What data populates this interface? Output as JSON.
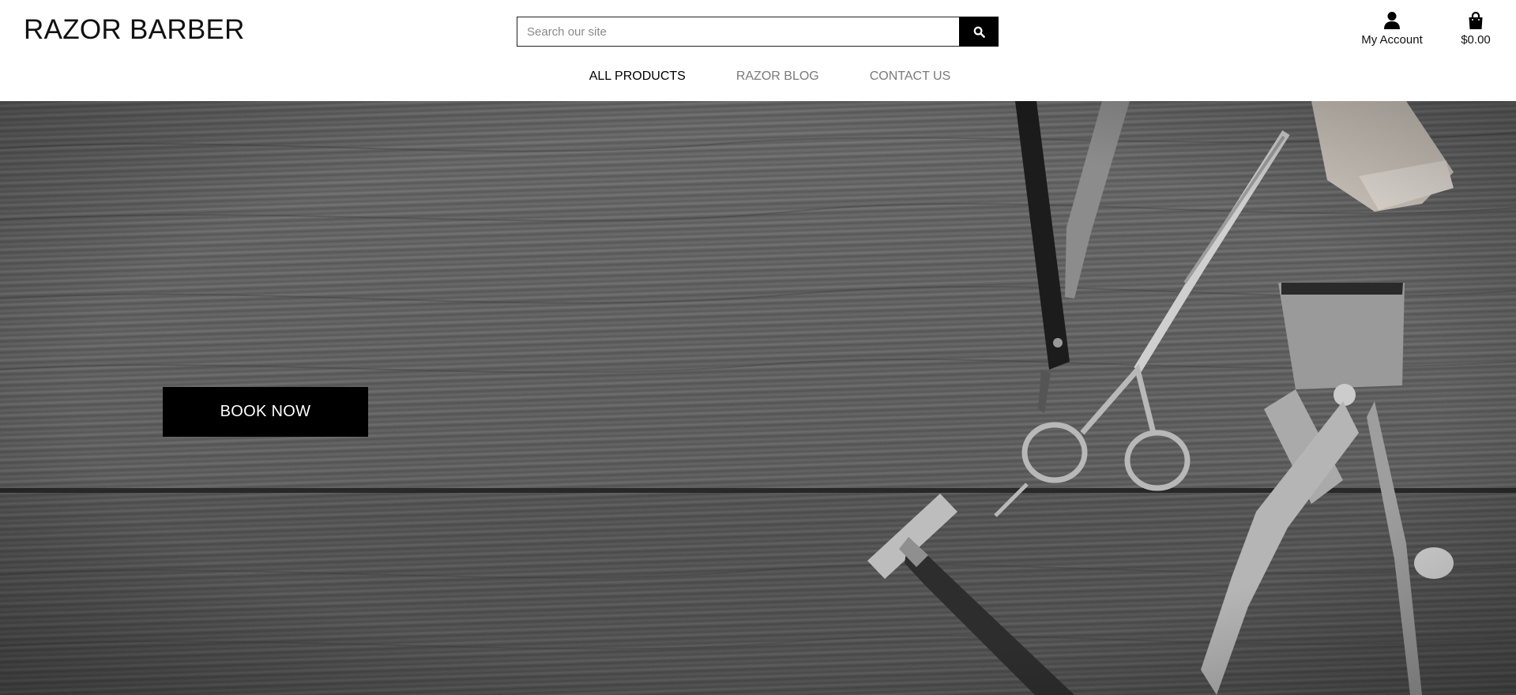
{
  "brand": {
    "name": "RAZOR BARBER"
  },
  "search": {
    "placeholder": "Search our site",
    "icon": "search-icon"
  },
  "header": {
    "account_label": "My Account",
    "account_icon": "user-icon",
    "cart_total": "$0.00",
    "cart_icon": "shopping-bag-icon"
  },
  "nav": {
    "items": [
      {
        "label": "ALL PRODUCTS",
        "active": true
      },
      {
        "label": "RAZOR BLOG",
        "active": false
      },
      {
        "label": "CONTACT US",
        "active": false
      }
    ]
  },
  "hero": {
    "cta_label": "BOOK NOW",
    "image": "barber-tools-on-wood-photo"
  },
  "colors": {
    "header_bg": "#ffffff",
    "button_bg": "#000000",
    "button_text": "#ffffff",
    "nav_active": "#000000",
    "nav_inactive": "#7a7a7a"
  }
}
